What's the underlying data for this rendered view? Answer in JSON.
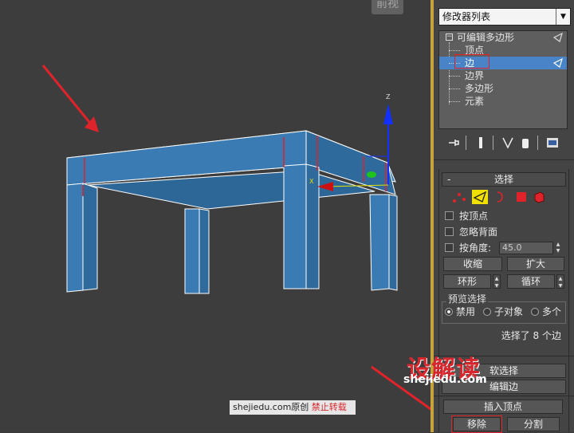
{
  "viewport": {
    "label": "前视"
  },
  "panel": {
    "modifier_list": "修改器列表",
    "stack": {
      "root": "可编辑多边形",
      "items": [
        "顶点",
        "边",
        "边界",
        "多边形",
        "元素"
      ],
      "selected_index": 1
    },
    "selection": {
      "title": "选择",
      "collapse_symbol": "-",
      "by_vertex": "按顶点",
      "ignore_backfacing": "忽略背面",
      "by_angle": "按角度:",
      "angle_value": "45.0",
      "shrink": "收缩",
      "grow": "扩大",
      "ring": "环形",
      "loop": "循环",
      "preview_title": "预览选择",
      "preview_off": "禁用",
      "preview_subobj": "子对象",
      "preview_multi": "多个",
      "status": "选择了 8 个边"
    },
    "soft_selection": "软选择",
    "edit_edges": "编辑边",
    "insert_vertex": "插入顶点",
    "remove": "移除",
    "split": "分割"
  },
  "watermark": {
    "logo": "设解读",
    "url": "shejiedu.com",
    "credit_site": "shejiedu.com原创",
    "credit_warning": "禁止转载"
  },
  "colors": {
    "accent": "#4a84c8",
    "highlight_red": "#e0232a",
    "model_blue": "#3a79b0"
  }
}
